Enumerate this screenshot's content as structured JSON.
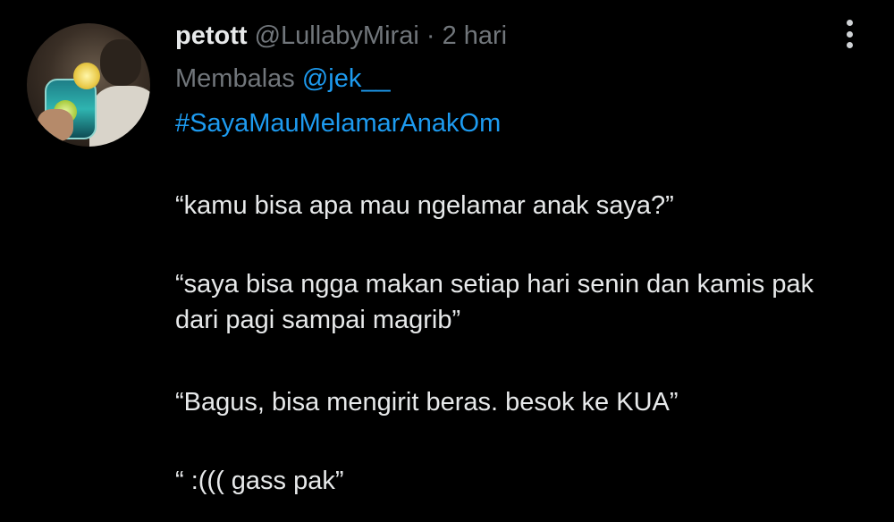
{
  "tweet": {
    "display_name": "petott",
    "handle": "@LullabyMirai",
    "separator": "·",
    "time": "2 hari",
    "replying_prefix": "Membalas ",
    "replying_to": "@jek__",
    "hashtag": "#SayaMauMelamarAnakOm",
    "paragraphs": [
      "“kamu bisa apa mau ngelamar anak saya?”",
      "“saya bisa ngga makan setiap hari senin dan kamis pak dari pagi sampai magrib”",
      "“Bagus, bisa mengirit beras. besok ke KUA”",
      "“ :((( gass pak”"
    ]
  },
  "icons": {
    "more": "more-vertical-icon"
  },
  "colors": {
    "background": "#000000",
    "text": "#e7e9ea",
    "muted": "#71767b",
    "link": "#1d9bf0"
  }
}
